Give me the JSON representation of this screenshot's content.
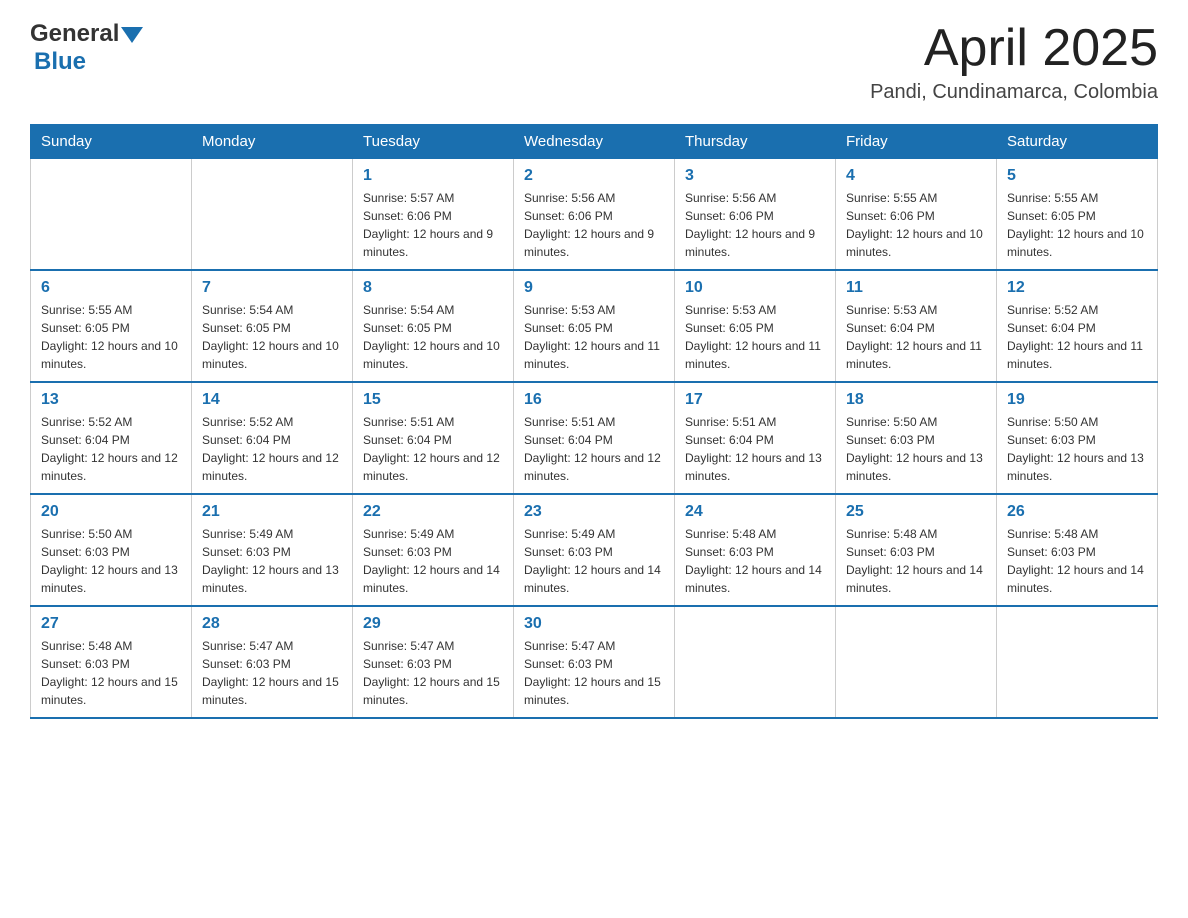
{
  "header": {
    "logo_general": "General",
    "logo_blue": "Blue",
    "title": "April 2025",
    "subtitle": "Pandi, Cundinamarca, Colombia"
  },
  "calendar": {
    "days_of_week": [
      "Sunday",
      "Monday",
      "Tuesday",
      "Wednesday",
      "Thursday",
      "Friday",
      "Saturday"
    ],
    "weeks": [
      [
        {
          "day": "",
          "sunrise": "",
          "sunset": "",
          "daylight": ""
        },
        {
          "day": "",
          "sunrise": "",
          "sunset": "",
          "daylight": ""
        },
        {
          "day": "1",
          "sunrise": "Sunrise: 5:57 AM",
          "sunset": "Sunset: 6:06 PM",
          "daylight": "Daylight: 12 hours and 9 minutes."
        },
        {
          "day": "2",
          "sunrise": "Sunrise: 5:56 AM",
          "sunset": "Sunset: 6:06 PM",
          "daylight": "Daylight: 12 hours and 9 minutes."
        },
        {
          "day": "3",
          "sunrise": "Sunrise: 5:56 AM",
          "sunset": "Sunset: 6:06 PM",
          "daylight": "Daylight: 12 hours and 9 minutes."
        },
        {
          "day": "4",
          "sunrise": "Sunrise: 5:55 AM",
          "sunset": "Sunset: 6:06 PM",
          "daylight": "Daylight: 12 hours and 10 minutes."
        },
        {
          "day": "5",
          "sunrise": "Sunrise: 5:55 AM",
          "sunset": "Sunset: 6:05 PM",
          "daylight": "Daylight: 12 hours and 10 minutes."
        }
      ],
      [
        {
          "day": "6",
          "sunrise": "Sunrise: 5:55 AM",
          "sunset": "Sunset: 6:05 PM",
          "daylight": "Daylight: 12 hours and 10 minutes."
        },
        {
          "day": "7",
          "sunrise": "Sunrise: 5:54 AM",
          "sunset": "Sunset: 6:05 PM",
          "daylight": "Daylight: 12 hours and 10 minutes."
        },
        {
          "day": "8",
          "sunrise": "Sunrise: 5:54 AM",
          "sunset": "Sunset: 6:05 PM",
          "daylight": "Daylight: 12 hours and 10 minutes."
        },
        {
          "day": "9",
          "sunrise": "Sunrise: 5:53 AM",
          "sunset": "Sunset: 6:05 PM",
          "daylight": "Daylight: 12 hours and 11 minutes."
        },
        {
          "day": "10",
          "sunrise": "Sunrise: 5:53 AM",
          "sunset": "Sunset: 6:05 PM",
          "daylight": "Daylight: 12 hours and 11 minutes."
        },
        {
          "day": "11",
          "sunrise": "Sunrise: 5:53 AM",
          "sunset": "Sunset: 6:04 PM",
          "daylight": "Daylight: 12 hours and 11 minutes."
        },
        {
          "day": "12",
          "sunrise": "Sunrise: 5:52 AM",
          "sunset": "Sunset: 6:04 PM",
          "daylight": "Daylight: 12 hours and 11 minutes."
        }
      ],
      [
        {
          "day": "13",
          "sunrise": "Sunrise: 5:52 AM",
          "sunset": "Sunset: 6:04 PM",
          "daylight": "Daylight: 12 hours and 12 minutes."
        },
        {
          "day": "14",
          "sunrise": "Sunrise: 5:52 AM",
          "sunset": "Sunset: 6:04 PM",
          "daylight": "Daylight: 12 hours and 12 minutes."
        },
        {
          "day": "15",
          "sunrise": "Sunrise: 5:51 AM",
          "sunset": "Sunset: 6:04 PM",
          "daylight": "Daylight: 12 hours and 12 minutes."
        },
        {
          "day": "16",
          "sunrise": "Sunrise: 5:51 AM",
          "sunset": "Sunset: 6:04 PM",
          "daylight": "Daylight: 12 hours and 12 minutes."
        },
        {
          "day": "17",
          "sunrise": "Sunrise: 5:51 AM",
          "sunset": "Sunset: 6:04 PM",
          "daylight": "Daylight: 12 hours and 13 minutes."
        },
        {
          "day": "18",
          "sunrise": "Sunrise: 5:50 AM",
          "sunset": "Sunset: 6:03 PM",
          "daylight": "Daylight: 12 hours and 13 minutes."
        },
        {
          "day": "19",
          "sunrise": "Sunrise: 5:50 AM",
          "sunset": "Sunset: 6:03 PM",
          "daylight": "Daylight: 12 hours and 13 minutes."
        }
      ],
      [
        {
          "day": "20",
          "sunrise": "Sunrise: 5:50 AM",
          "sunset": "Sunset: 6:03 PM",
          "daylight": "Daylight: 12 hours and 13 minutes."
        },
        {
          "day": "21",
          "sunrise": "Sunrise: 5:49 AM",
          "sunset": "Sunset: 6:03 PM",
          "daylight": "Daylight: 12 hours and 13 minutes."
        },
        {
          "day": "22",
          "sunrise": "Sunrise: 5:49 AM",
          "sunset": "Sunset: 6:03 PM",
          "daylight": "Daylight: 12 hours and 14 minutes."
        },
        {
          "day": "23",
          "sunrise": "Sunrise: 5:49 AM",
          "sunset": "Sunset: 6:03 PM",
          "daylight": "Daylight: 12 hours and 14 minutes."
        },
        {
          "day": "24",
          "sunrise": "Sunrise: 5:48 AM",
          "sunset": "Sunset: 6:03 PM",
          "daylight": "Daylight: 12 hours and 14 minutes."
        },
        {
          "day": "25",
          "sunrise": "Sunrise: 5:48 AM",
          "sunset": "Sunset: 6:03 PM",
          "daylight": "Daylight: 12 hours and 14 minutes."
        },
        {
          "day": "26",
          "sunrise": "Sunrise: 5:48 AM",
          "sunset": "Sunset: 6:03 PM",
          "daylight": "Daylight: 12 hours and 14 minutes."
        }
      ],
      [
        {
          "day": "27",
          "sunrise": "Sunrise: 5:48 AM",
          "sunset": "Sunset: 6:03 PM",
          "daylight": "Daylight: 12 hours and 15 minutes."
        },
        {
          "day": "28",
          "sunrise": "Sunrise: 5:47 AM",
          "sunset": "Sunset: 6:03 PM",
          "daylight": "Daylight: 12 hours and 15 minutes."
        },
        {
          "day": "29",
          "sunrise": "Sunrise: 5:47 AM",
          "sunset": "Sunset: 6:03 PM",
          "daylight": "Daylight: 12 hours and 15 minutes."
        },
        {
          "day": "30",
          "sunrise": "Sunrise: 5:47 AM",
          "sunset": "Sunset: 6:03 PM",
          "daylight": "Daylight: 12 hours and 15 minutes."
        },
        {
          "day": "",
          "sunrise": "",
          "sunset": "",
          "daylight": ""
        },
        {
          "day": "",
          "sunrise": "",
          "sunset": "",
          "daylight": ""
        },
        {
          "day": "",
          "sunrise": "",
          "sunset": "",
          "daylight": ""
        }
      ]
    ]
  }
}
